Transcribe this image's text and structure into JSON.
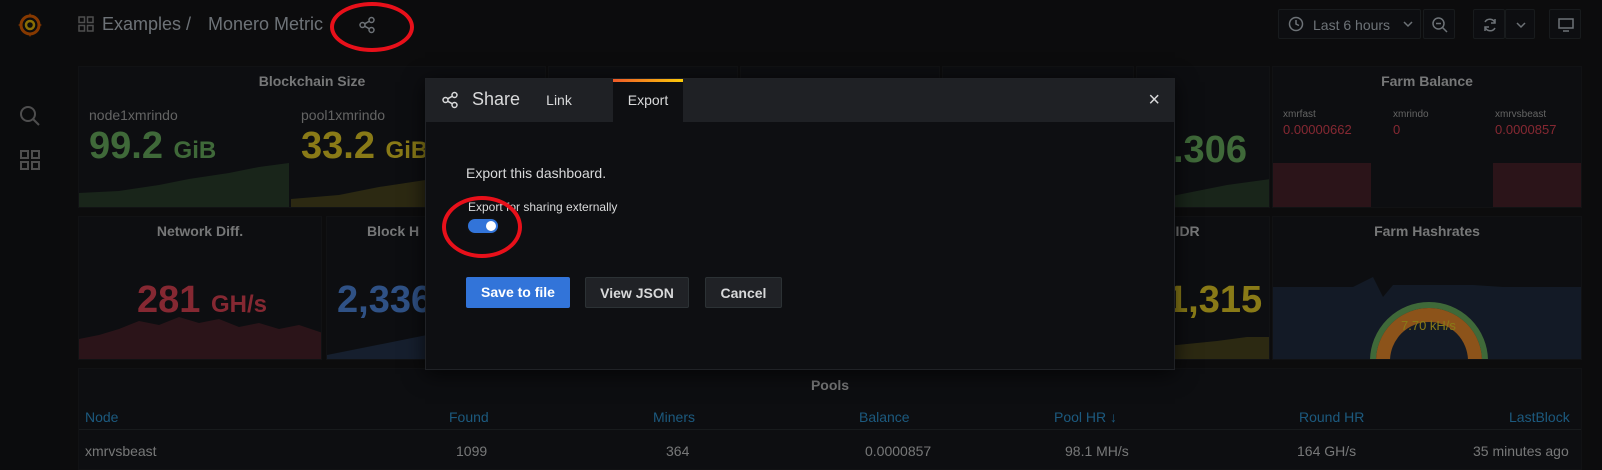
{
  "breadcrumb": {
    "folder": "Examples",
    "separator": "/",
    "dashboard": "Monero Metric"
  },
  "toolbar": {
    "time_range": "Last 6 hours"
  },
  "panels": {
    "blockchain_size": {
      "title": "Blockchain Size",
      "s1_label": "node1xmrindo",
      "s1_value": "99.2",
      "s1_unit": "GiB",
      "s2_label": "pool1xmrindo",
      "s2_value": "33.2",
      "s2_unit": "GiB"
    },
    "farm_balance": {
      "title": "Farm Balance",
      "c1_label": "xmrfast",
      "c1_value": "0.00000662",
      "c2_label": "xmrindo",
      "c2_value": "0",
      "c3_label": "xmrvsbeast",
      "c3_value": "0.0000857"
    },
    "network_diff": {
      "title": "Network Diff.",
      "value": "281",
      "unit": "GH/s"
    },
    "block_height": {
      "title": "Block H",
      "value": "2,336"
    },
    "trans_vol": {
      "value": ".306"
    },
    "idr": {
      "title": "- IDR",
      "value": "1,315"
    },
    "farm_hashrates": {
      "title": "Farm Hashrates",
      "value": "7.70 kH/s"
    },
    "pools": {
      "title": "Pools",
      "columns": [
        "Node",
        "Found",
        "Miners",
        "Balance",
        "Pool HR ↓",
        "Round HR",
        "LastBlock"
      ],
      "row": [
        "xmrvsbeast",
        "1099",
        "364",
        "0.0000857",
        "98.1 MH/s",
        "164 GH/s",
        "35 minutes ago"
      ]
    }
  },
  "modal": {
    "title": "Share",
    "tab_link": "Link",
    "tab_export": "Export",
    "close": "×",
    "description": "Export this dashboard.",
    "toggle_label": "Export for sharing externally",
    "toggle_on": true,
    "save_button": "Save to file",
    "view_json_button": "View JSON",
    "cancel_button": "Cancel"
  },
  "colors": {
    "accent_blue": "#3274d9",
    "green": "#73bf69",
    "yellow": "#fade2a",
    "red": "#f2495c",
    "annotation_red": "#e8101a"
  }
}
